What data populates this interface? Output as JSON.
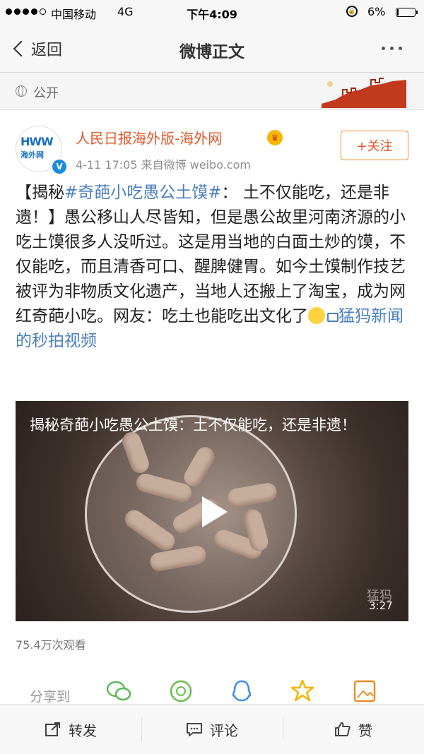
{
  "status_bar": {
    "carrier": "中国移动",
    "network": "4G",
    "time": "下午4:09",
    "battery_percent": "6%"
  },
  "nav": {
    "back_label": "返回",
    "title": "微博正文"
  },
  "visibility": {
    "label": "公开"
  },
  "post": {
    "author": "人民日报海外版-海外网",
    "meta": "4-11 17:05  来自微博 weibo.com",
    "follow_label": "+关注",
    "avatar_text_top": "HWW",
    "avatar_text_bottom": "海外网",
    "text_prefix": "【揭秘",
    "topic": "#奇葩小吃愚公土馍#",
    "text_main": "： 土不仅能吃，还是非遗！】愚公移山人尽皆知，但是愚公故里河南济源的小吃土馍很多人没听过。这是用当地的白面土炒的馍，不仅能吃，而且清香可口、醒脾健胃。如今土馍制作技艺被评为非物质文化遗产，当地人还搬上了淘宝，成为网红奇葩小吃。网友：吃土也能吃出文化了",
    "video_link": "猛犸新闻的秒拍视频"
  },
  "video": {
    "title": "揭秘奇葩小吃愚公土馍：土不仅能吃，还是非遗！",
    "duration": "3:27",
    "watermark": "猛犸"
  },
  "views": "75.4万次观看",
  "share": {
    "label": "分享到"
  },
  "bottom_bar": {
    "repost": "转发",
    "comment": "评论",
    "like": "赞"
  },
  "colors": {
    "author": "#e3582a",
    "link": "#4a7fbd",
    "follow_border": "#f08a2a"
  }
}
